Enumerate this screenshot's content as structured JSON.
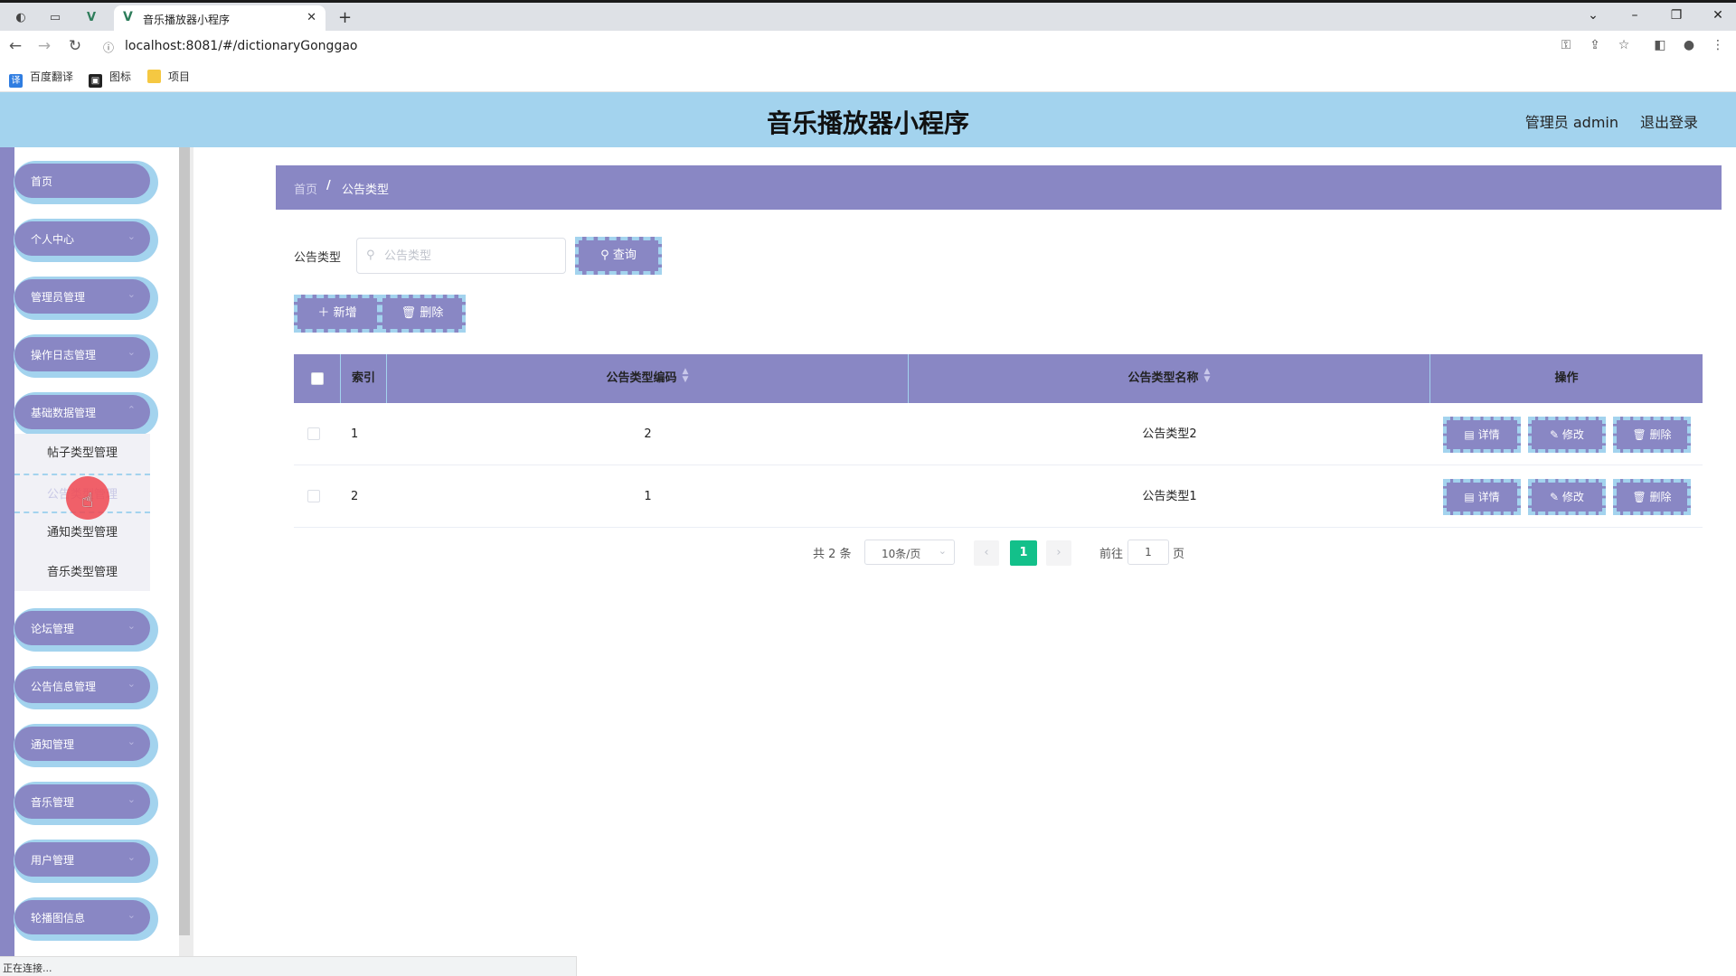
{
  "browser": {
    "tab_title": "音乐播放器小程序",
    "url": "localhost:8081/#/dictionaryGonggao",
    "bookmarks": [
      "百度翻译",
      "图标",
      "项目"
    ],
    "status_text": "正在连接..."
  },
  "header": {
    "title": "音乐播放器小程序",
    "user": "管理员 admin",
    "logout": "退出登录"
  },
  "sidebar": {
    "items": [
      {
        "label": "首页"
      },
      {
        "label": "个人中心"
      },
      {
        "label": "管理员管理"
      },
      {
        "label": "操作日志管理"
      },
      {
        "label": "基础数据管理"
      },
      {
        "label": "论坛管理"
      },
      {
        "label": "公告信息管理"
      },
      {
        "label": "通知管理"
      },
      {
        "label": "音乐管理"
      },
      {
        "label": "用户管理"
      },
      {
        "label": "轮播图信息"
      }
    ],
    "submenu": [
      {
        "label": "帖子类型管理"
      },
      {
        "label": "公告类型管理"
      },
      {
        "label": "通知类型管理"
      },
      {
        "label": "音乐类型管理"
      }
    ]
  },
  "breadcrumb": {
    "home": "首页",
    "separator": "/",
    "current": "公告类型"
  },
  "search": {
    "label": "公告类型",
    "placeholder": "公告类型",
    "query_button": "查询"
  },
  "actions": {
    "add": "新增",
    "delete": "删除"
  },
  "table": {
    "headers": [
      "索引",
      "公告类型编码",
      "公告类型名称",
      "操作"
    ],
    "rows": [
      {
        "index": "1",
        "code": "2",
        "name": "公告类型2"
      },
      {
        "index": "2",
        "code": "1",
        "name": "公告类型1"
      }
    ],
    "row_actions": {
      "detail": "详情",
      "edit": "修改",
      "delete": "删除"
    }
  },
  "pagination": {
    "total": "共 2 条",
    "page_size": "10条/页",
    "current_page": "1",
    "goto_label": "前往",
    "goto_value": "1",
    "page_suffix": "页"
  },
  "colors": {
    "accent_purple": "#8987c4",
    "accent_blue": "#a3d3ee",
    "active_page": "#13c08a"
  }
}
